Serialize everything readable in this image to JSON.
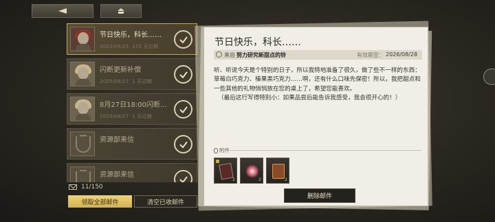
{
  "nav": {
    "back_icon": "triangle-left-icon",
    "home_icon": "home-icon"
  },
  "mail_list": {
    "items": [
      {
        "title": "节日快乐，科长……",
        "date": "2025/08/25",
        "remaining": "155 天过期",
        "avatar": "red-hair-girl",
        "active": true
      },
      {
        "title": "闪断更新补偿",
        "date": "2025/08/27",
        "remaining": "1 天过期",
        "avatar": "blonde-girl",
        "active": false
      },
      {
        "title": "8月27日18:00闪断…",
        "date": "2025/08/27",
        "remaining": "1 天过期",
        "avatar": "blonde-girl",
        "active": false
      },
      {
        "title": "资源部来信",
        "date": "",
        "remaining": "",
        "avatar": "emblem",
        "active": false
      },
      {
        "title": "资源部来信",
        "date": "",
        "remaining": "",
        "avatar": "emblem",
        "active": false
      }
    ],
    "count_text": "11/150",
    "collect_all_label": "领取全部邮件",
    "clear_collected_label": "清空已收邮件"
  },
  "detail": {
    "title": "节日快乐，科长……",
    "from_label": "来自",
    "from_value": "努力研究新甜点的铃",
    "expiry_label": "有效期至：",
    "expiry_value": "2026/08/28",
    "body_lines": [
      "听、听说今天是个特别的日子，所以我特地准备了很久，做了些不一样的东西：草莓白巧克力、榛果黑巧克力……啊，还有什么口味先保密！所以，我把甜点和一些其他的礼物悄悄放在您的桌上了，希望您能喜欢。",
      "（最后这行写得特别小：如果品尝后能告诉我感受，我会很开心的！）"
    ],
    "attachments_label": "附件",
    "attachments": [
      {
        "icon": "chocolate-box-icon",
        "qty": "2"
      },
      {
        "icon": "sparkle-gift-icon",
        "qty": "2"
      },
      {
        "icon": "gift-bag-icon",
        "qty": "2"
      }
    ],
    "delete_label": "删除邮件"
  }
}
